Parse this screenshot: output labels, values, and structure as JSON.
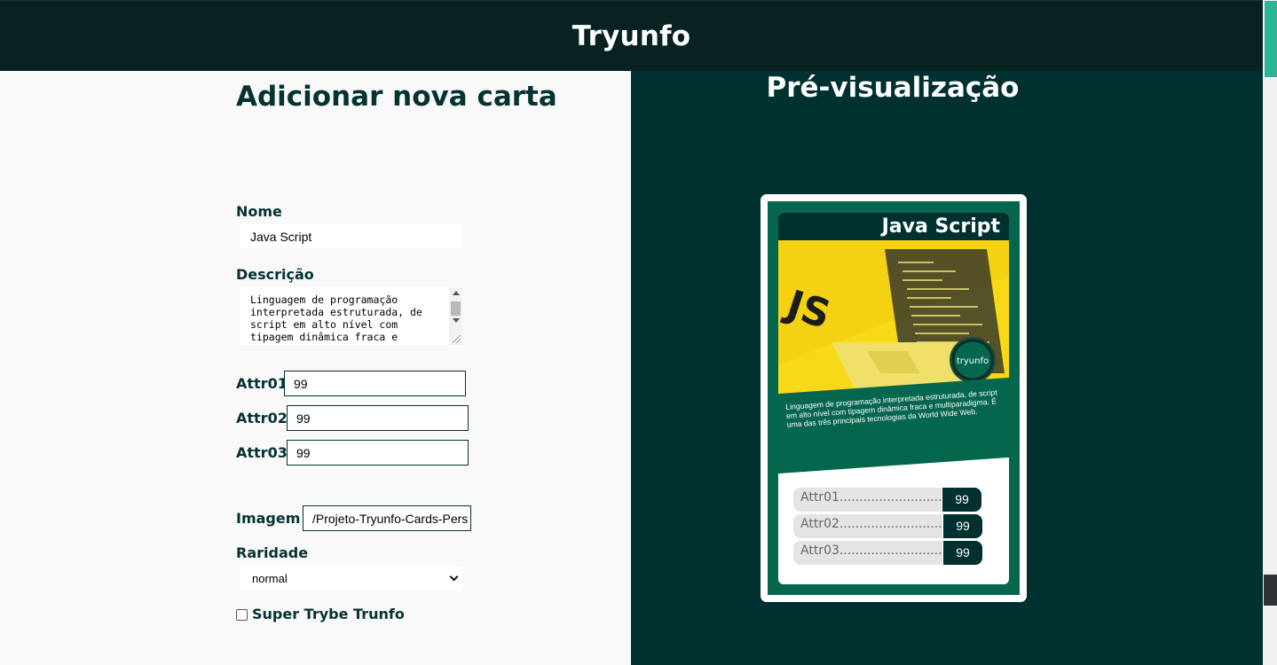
{
  "header": {
    "title": "Tryunfo"
  },
  "form": {
    "title": "Adicionar nova carta",
    "name_label": "Nome",
    "name_value": "Java Script",
    "description_label": "Descrição",
    "description_value": "Linguagem de programação interpretada estruturada, de script em alto nível com tipagem dinâmica fraca e",
    "attr1_label": "Attr01",
    "attr1_value": "99",
    "attr2_label": "Attr02",
    "attr2_value": "99",
    "attr3_label": "Attr03",
    "attr3_value": "99",
    "image_label": "Imagem",
    "image_value": "/Projeto-Tryunfo-Cards-Pers",
    "rarity_label": "Raridade",
    "rarity_value": "normal",
    "supertrunfo_label": "Super Trybe Trunfo",
    "supertrunfo_checked": false
  },
  "preview": {
    "title": "Pré-visualização",
    "card": {
      "name": "Java Script",
      "image_logo": "JS",
      "image_badge": "tryunfo",
      "description": "Linguagem de programação interpretada estruturada, de script em alto nível com tipagem dinâmica fraca e multiparadigma. É uma das três principais tecnologias da World Wide Web.",
      "attributes": [
        {
          "name": "Attr01................................",
          "value": "99"
        },
        {
          "name": "Attr02................................",
          "value": "99"
        },
        {
          "name": "Attr03................................",
          "value": "99"
        }
      ]
    }
  },
  "colors": {
    "header_bg": "#082121",
    "preview_bg": "#003030",
    "card_green": "#05664e",
    "card_yellow": "#f7d917",
    "scroll_thumb": "#2bb596"
  }
}
